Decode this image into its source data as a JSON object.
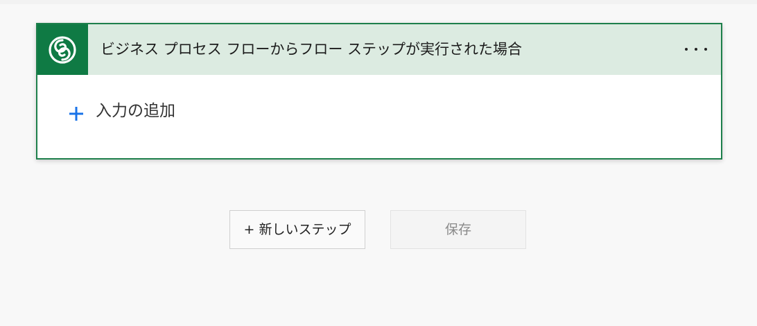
{
  "trigger_card": {
    "title": "ビジネス プロセス フローからフロー ステップが実行された場合",
    "icon": "dataverse-icon",
    "menu_icon": "more-options-icon",
    "add_input_label": "入力の追加",
    "accent_color": "#0f7a44",
    "header_color": "#dcebe1"
  },
  "actions": {
    "new_step_label": "+ 新しいステップ",
    "save_label": "保存"
  }
}
